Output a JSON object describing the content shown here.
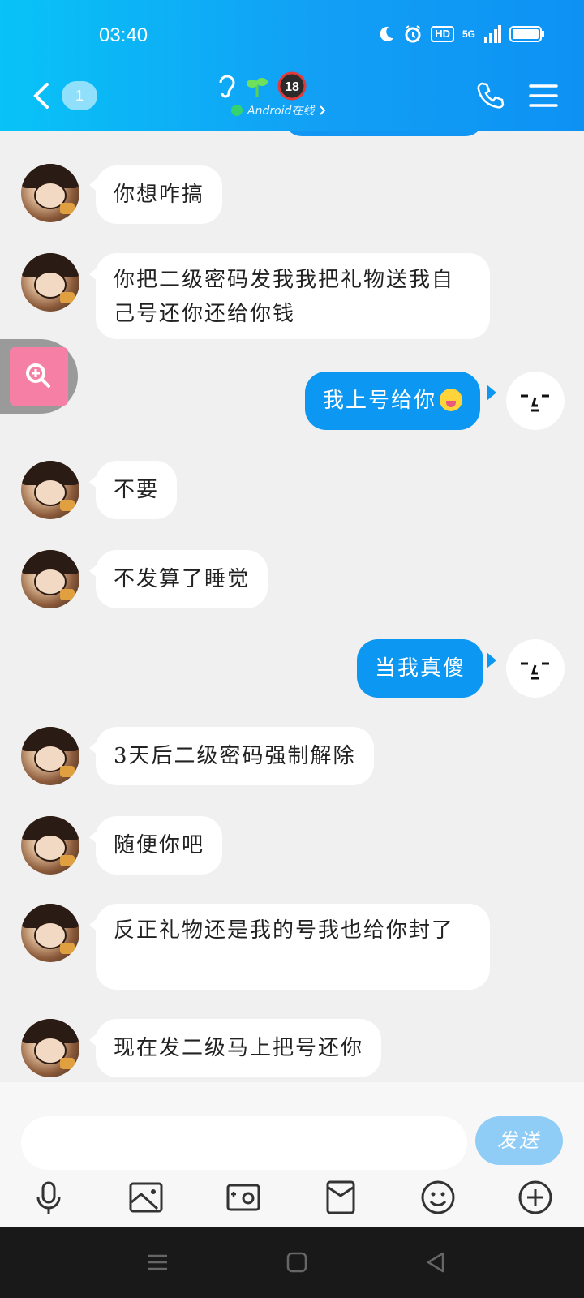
{
  "status_bar": {
    "time": "03:40",
    "hd_label": "HD",
    "network_label": "5G"
  },
  "header": {
    "unread_count": "1",
    "online_status": "Android在线",
    "badge_icons": [
      "ear-icon",
      "sprout-icon",
      "age-18-icon"
    ]
  },
  "messages": [
    {
      "side": "left",
      "text": "你想咋搞"
    },
    {
      "side": "left",
      "text": "你把二级密码发我我把礼物送我自己号还你还给你钱"
    },
    {
      "side": "right",
      "text": "我上号给你"
    },
    {
      "side": "left",
      "text": "不要"
    },
    {
      "side": "left",
      "text": "不发算了睡觉"
    },
    {
      "side": "right",
      "text": "当我真傻"
    },
    {
      "side": "left",
      "text": "3天后二级密码强制解除"
    },
    {
      "side": "left",
      "text": "随便你吧"
    },
    {
      "side": "left",
      "text": "反正礼物还是我的号我也给你封了"
    },
    {
      "side": "left",
      "text": "现在发二级马上把号还你"
    }
  ],
  "input": {
    "placeholder": "",
    "value": "",
    "send_label": "发送"
  },
  "toolbar": [
    "microphone-icon",
    "image-icon",
    "camera-icon",
    "red-packet-icon",
    "emoji-icon",
    "plus-icon"
  ],
  "colors": {
    "header_start": "#08c3f7",
    "header_end": "#0d92f4",
    "my_bubble": "#0b97f2",
    "send_button": "#8fcdf7",
    "background": "#f0f0f0"
  }
}
